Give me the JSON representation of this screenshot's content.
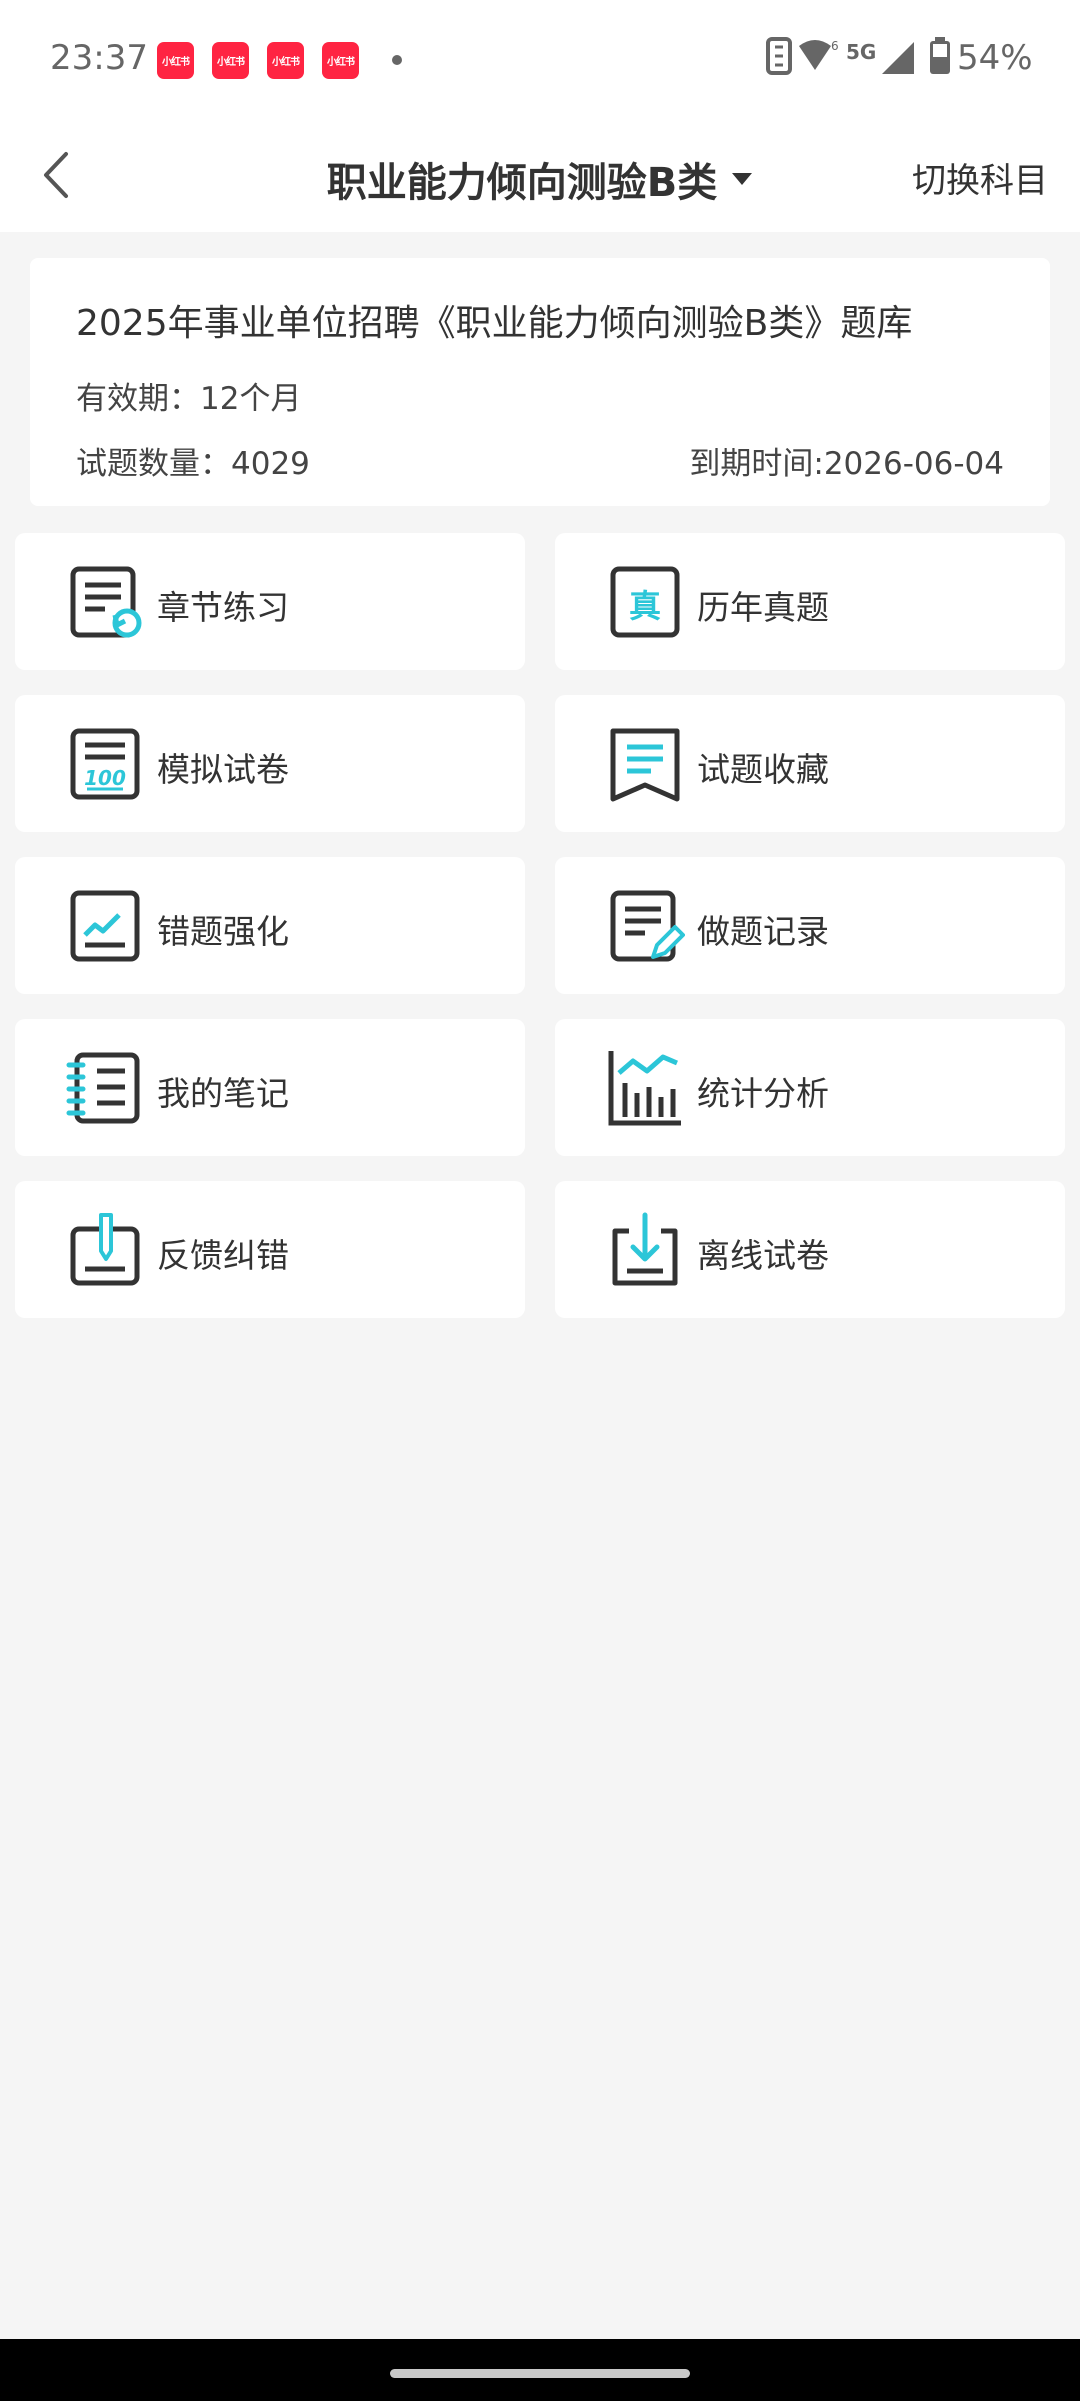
{
  "status_bar": {
    "time": "23:37",
    "notification_apps": [
      "小红书",
      "小红书",
      "小红书",
      "小红书"
    ],
    "network": "5G",
    "battery": "54%"
  },
  "header": {
    "title": "职业能力倾向测验B类",
    "switch_label": "切换科目"
  },
  "info": {
    "title": "2025年事业单位招聘《职业能力倾向测验B类》题库",
    "validity": "有效期：12个月",
    "count": "试题数量：4029",
    "expire": "到期时间:2026-06-04"
  },
  "menu": [
    {
      "label": "章节练习",
      "icon": "chapter-practice-icon"
    },
    {
      "label": "历年真题",
      "icon": "past-exams-icon"
    },
    {
      "label": "模拟试卷",
      "icon": "mock-paper-icon"
    },
    {
      "label": "试题收藏",
      "icon": "bookmark-icon"
    },
    {
      "label": "错题强化",
      "icon": "wrong-questions-icon"
    },
    {
      "label": "做题记录",
      "icon": "practice-record-icon"
    },
    {
      "label": "我的笔记",
      "icon": "notes-icon"
    },
    {
      "label": "统计分析",
      "icon": "statistics-icon"
    },
    {
      "label": "反馈纠错",
      "icon": "feedback-icon"
    },
    {
      "label": "离线试卷",
      "icon": "download-icon"
    }
  ],
  "colors": {
    "accent": "#2cc6d8",
    "icon_dark": "#333333",
    "background": "#f5f5f5",
    "notification": "#ff2442"
  }
}
